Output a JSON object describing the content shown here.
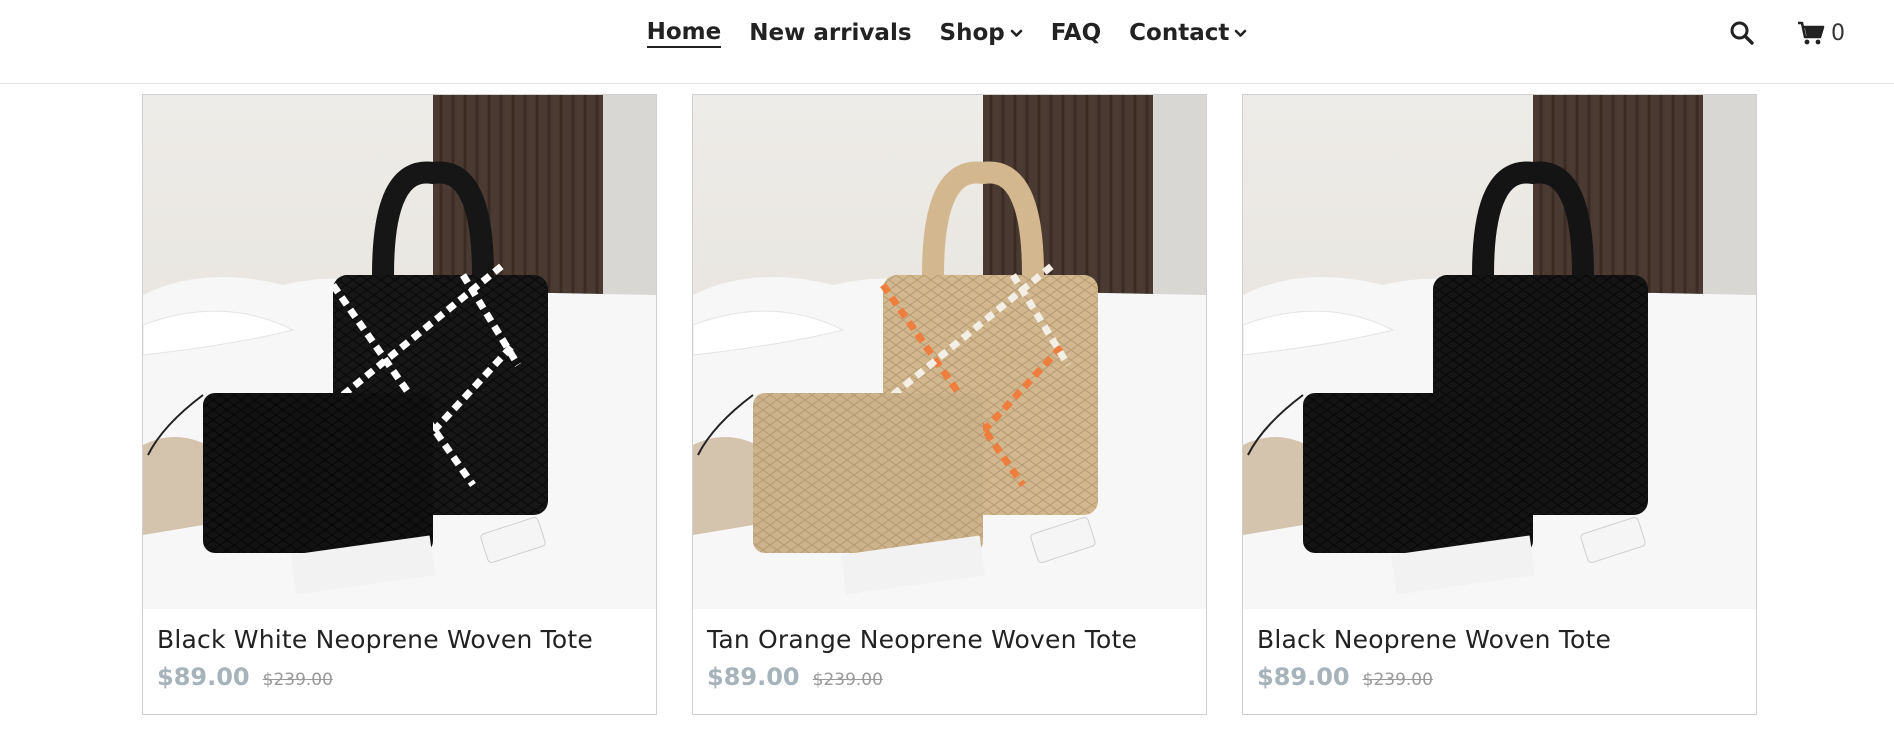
{
  "nav": {
    "items": [
      {
        "label": "Home",
        "active": true,
        "dropdown": false
      },
      {
        "label": "New arrivals",
        "active": false,
        "dropdown": false
      },
      {
        "label": "Shop",
        "active": false,
        "dropdown": true
      },
      {
        "label": "FAQ",
        "active": false,
        "dropdown": false
      },
      {
        "label": "Contact",
        "active": false,
        "dropdown": true
      }
    ],
    "search_icon": "search-icon",
    "cart_icon": "shopping-cart-icon",
    "cart_count": "0"
  },
  "products": [
    {
      "title": "Black White Neoprene Woven Tote",
      "price": "$89.00",
      "compare_price": "$239.00",
      "bag_color": "#161616",
      "stripe_color": "#ffffff",
      "stripe2_color": "#ffffff",
      "pouch_color": "#121212"
    },
    {
      "title": "Tan Orange Neoprene Woven Tote",
      "price": "$89.00",
      "compare_price": "$239.00",
      "bag_color": "#d3b88f",
      "stripe_color": "#ee7d3e",
      "stripe2_color": "#f4efe6",
      "pouch_color": "#cdb38b"
    },
    {
      "title": "Black Neoprene Woven Tote",
      "price": "$89.00",
      "compare_price": "$239.00",
      "bag_color": "#141414",
      "stripe_color": "#141414",
      "stripe2_color": "#141414",
      "pouch_color": "#131313"
    }
  ],
  "colors": {
    "price": "#a7b3bb",
    "compare_price": "#999999",
    "text": "#222222"
  }
}
